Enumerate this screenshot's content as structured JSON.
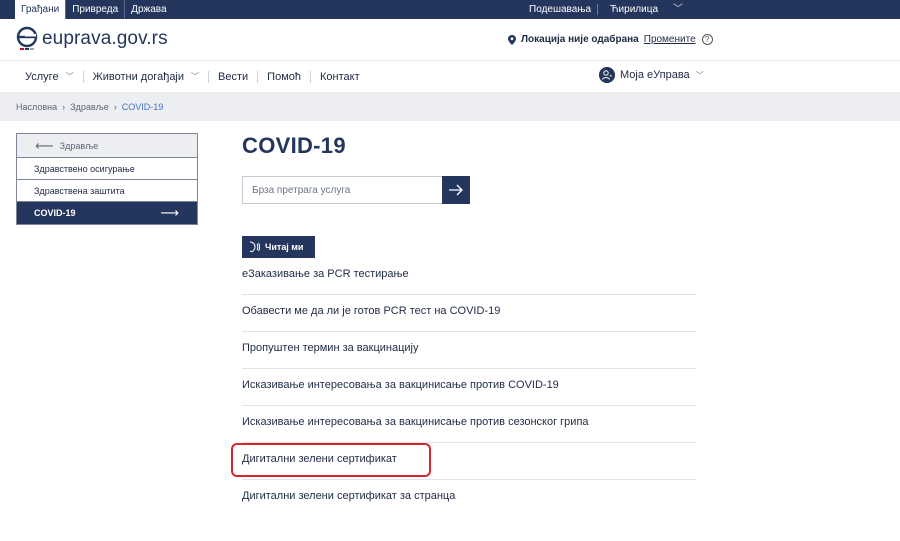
{
  "topbar": {
    "tabs": [
      "Грађани",
      "Привреда",
      "Држава"
    ],
    "settings": "Подешавања",
    "script": "Ћирилица"
  },
  "header": {
    "logo_text": "euprava.gov.rs",
    "location_label": "Локација није одабрана",
    "location_change": "Промените",
    "help": "?"
  },
  "nav": {
    "items": [
      "Услуге",
      "Животни догађаји",
      "Вести",
      "Помоћ",
      "Контакт"
    ],
    "account": "Моја еУправа"
  },
  "breadcrumb": [
    "Насловна",
    "Здравље",
    "COVID-19"
  ],
  "side": {
    "back": "Здравље",
    "items": [
      "Здравствено осигурање",
      "Здравствена заштита",
      "COVID-19"
    ]
  },
  "main": {
    "title": "COVID-19",
    "search_placeholder": "Брза претрага услуга",
    "read_button": "Читај ми",
    "services": [
      "еЗаказивање за PCR тестирање",
      "Обавести ме да ли је готов PCR тест на COVID-19",
      "Пропуштен термин за вакцинацију",
      "Исказивање интересовања за вакцинисање против COVID-19",
      "Исказивање интересовања за вакцинисање против сезонског грипа",
      "Дигитални зелени сертификат",
      "Дигитални зелени сертификат за странца"
    ],
    "highlight_color": "#d8262e"
  },
  "colors": {
    "brand_navy": "#24365d",
    "breadcrumb_current": "#3f74c7"
  }
}
